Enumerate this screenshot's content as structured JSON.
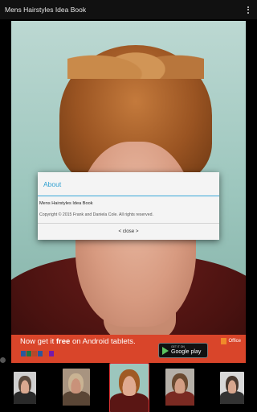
{
  "app": {
    "title": "Mens Hairstyles Idea Book",
    "overflow_icon": "overflow-menu-icon"
  },
  "dialog": {
    "title": "About",
    "app_name": "Mens Hairstyles Idea Book",
    "copyright": "Copyright © 2015 Frank and Daniela Cole. All rights reserved.",
    "close_label": "< close >"
  },
  "ad": {
    "headline_prefix": "Now get it ",
    "headline_bold": "free",
    "headline_suffix": " on Android tablets.",
    "store_small": "GET IT ON",
    "store_big": "Google play",
    "brand": "Office",
    "colors": {
      "background": "#d9452a",
      "play": "#5bc35f",
      "office": "#f08a2a"
    },
    "app_icon_colors": [
      "#2b579a",
      "#217346",
      "#b7472a",
      "#2b579a",
      "#d24726",
      "#7719aa"
    ]
  },
  "thumbnails": [
    {
      "label": "hairstyle-1",
      "bg": "#cfcfcf",
      "hair": "#5a4a3e",
      "skin": "#d9a890",
      "cloth": "#2a2a2a",
      "selected": false
    },
    {
      "label": "hairstyle-2",
      "bg": "#a89480",
      "hair": "#c9b393",
      "skin": "#c9927a",
      "cloth": "#5a4636",
      "selected": false
    },
    {
      "label": "hairstyle-3",
      "bg": "#9cc6bd",
      "hair": "#a05a24",
      "skin": "#e0aa90",
      "cloth": "#5a1614",
      "selected": true
    },
    {
      "label": "hairstyle-4",
      "bg": "#b5b0a8",
      "hair": "#6a4a30",
      "skin": "#d39e84",
      "cloth": "#7a2a22",
      "selected": false
    },
    {
      "label": "hairstyle-5",
      "bg": "#d8d8d8",
      "hair": "#4a3a30",
      "skin": "#d7a68e",
      "cloth": "#333333",
      "selected": false
    }
  ]
}
